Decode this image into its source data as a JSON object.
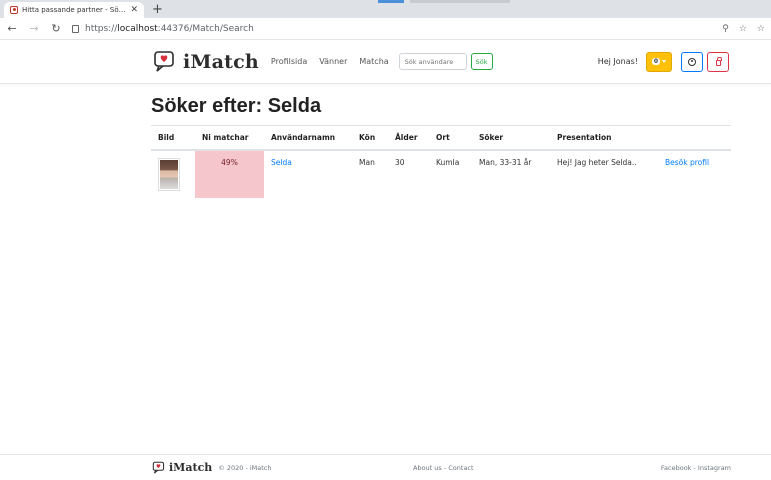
{
  "browser": {
    "tab_title": "Hitta passande partner - Söker e",
    "tab_close": "✕",
    "new_tab": "+",
    "url_prefix": "https://",
    "url_host": "localhost",
    "url_path": ":44376/Match/Search"
  },
  "header": {
    "brand": "iMatch",
    "nav": [
      "Profilsida",
      "Vänner",
      "Matcha"
    ],
    "search_placeholder": "Sök användare",
    "search_button": "Sök",
    "greeting": "Hej Jonas!",
    "notification_count": "0",
    "colors": {
      "notification": "#ffc107",
      "profile": "#007bff",
      "logout": "#dc3545",
      "search": "#28a745"
    }
  },
  "main": {
    "title": "Söker efter: Selda",
    "columns": [
      "Bild",
      "Ni matchar",
      "Användarnamn",
      "Kön",
      "Ålder",
      "Ort",
      "Söker",
      "Presentation",
      ""
    ],
    "rows": [
      {
        "match": "49%",
        "username": "Selda",
        "gender": "Man",
        "age": "30",
        "city": "Kumla",
        "seeking": "Man, 33-31 år",
        "presentation": "Hej! Jag heter Selda..",
        "action": "Besök profil"
      }
    ],
    "match_color": "#f5c6cb"
  },
  "footer": {
    "brand": "iMatch",
    "copyright": "© 2020 - iMatch",
    "center": "About us - Contact",
    "right": "Facebook - Instagram"
  }
}
